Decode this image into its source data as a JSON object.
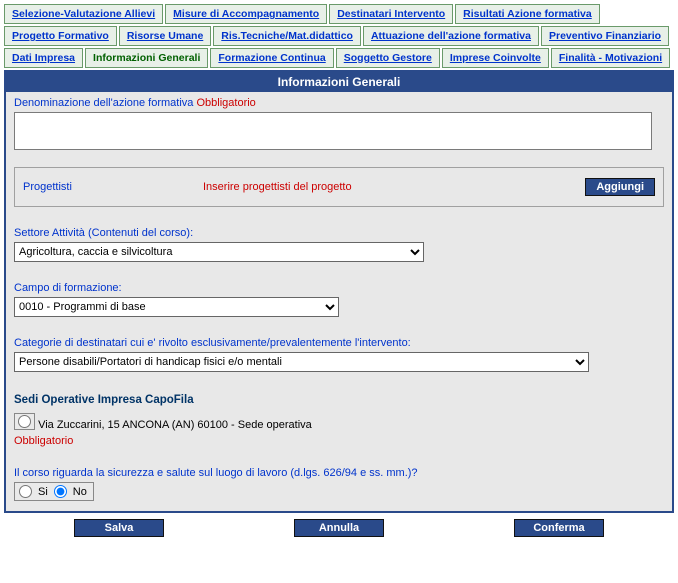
{
  "tabs_row1": [
    {
      "label": "Selezione-Valutazione Allievi"
    },
    {
      "label": "Misure di Accompagnamento"
    },
    {
      "label": "Destinatari Intervento"
    },
    {
      "label": "Risultati Azione formativa"
    }
  ],
  "tabs_row2": [
    {
      "label": "Progetto Formativo"
    },
    {
      "label": "Risorse Umane"
    },
    {
      "label": "Ris.Tecniche/Mat.didattico"
    },
    {
      "label": "Attuazione dell'azione formativa"
    },
    {
      "label": "Preventivo Finanziario"
    }
  ],
  "tabs_row3": [
    {
      "label": "Dati Impresa"
    },
    {
      "label": "Informazioni Generali",
      "active": true
    },
    {
      "label": "Formazione Continua"
    },
    {
      "label": "Soggetto Gestore"
    },
    {
      "label": "Imprese Coinvolte"
    },
    {
      "label": "Finalità - Motivazioni"
    }
  ],
  "panel": {
    "title": "Informazioni Generali",
    "denom_label": "Denominazione dell'azione formativa",
    "denom_required": "Obbligatorio",
    "denom_value": "",
    "progettisti_label": "Progettisti",
    "progettisti_hint": "Inserire progettisti del progetto",
    "aggiungi": "Aggiungi",
    "settore_label": "Settore Attività (Contenuti del corso):",
    "settore_value": "Agricoltura, caccia e silvicoltura",
    "campo_label": "Campo di formazione:",
    "campo_value": "0010 - Programmi di base",
    "categorie_label": "Categorie di destinatari cui e' rivolto esclusivamente/prevalentemente l'intervento:",
    "categorie_value": "Persone disabili/Portatori di handicap fisici e/o mentali",
    "sedi_title": "Sedi Operative Impresa CapoFila",
    "sede1": "Via Zuccarini, 15 ANCONA (AN) 60100 - Sede operativa",
    "sedi_required": "Obbligatorio",
    "sicurezza_label": "Il corso riguarda la sicurezza e salute sul luogo di lavoro (d.lgs. 626/94 e ss. mm.)?",
    "si": "Si",
    "no": "No"
  },
  "buttons": {
    "salva": "Salva",
    "annulla": "Annulla",
    "conferma": "Conferma"
  }
}
